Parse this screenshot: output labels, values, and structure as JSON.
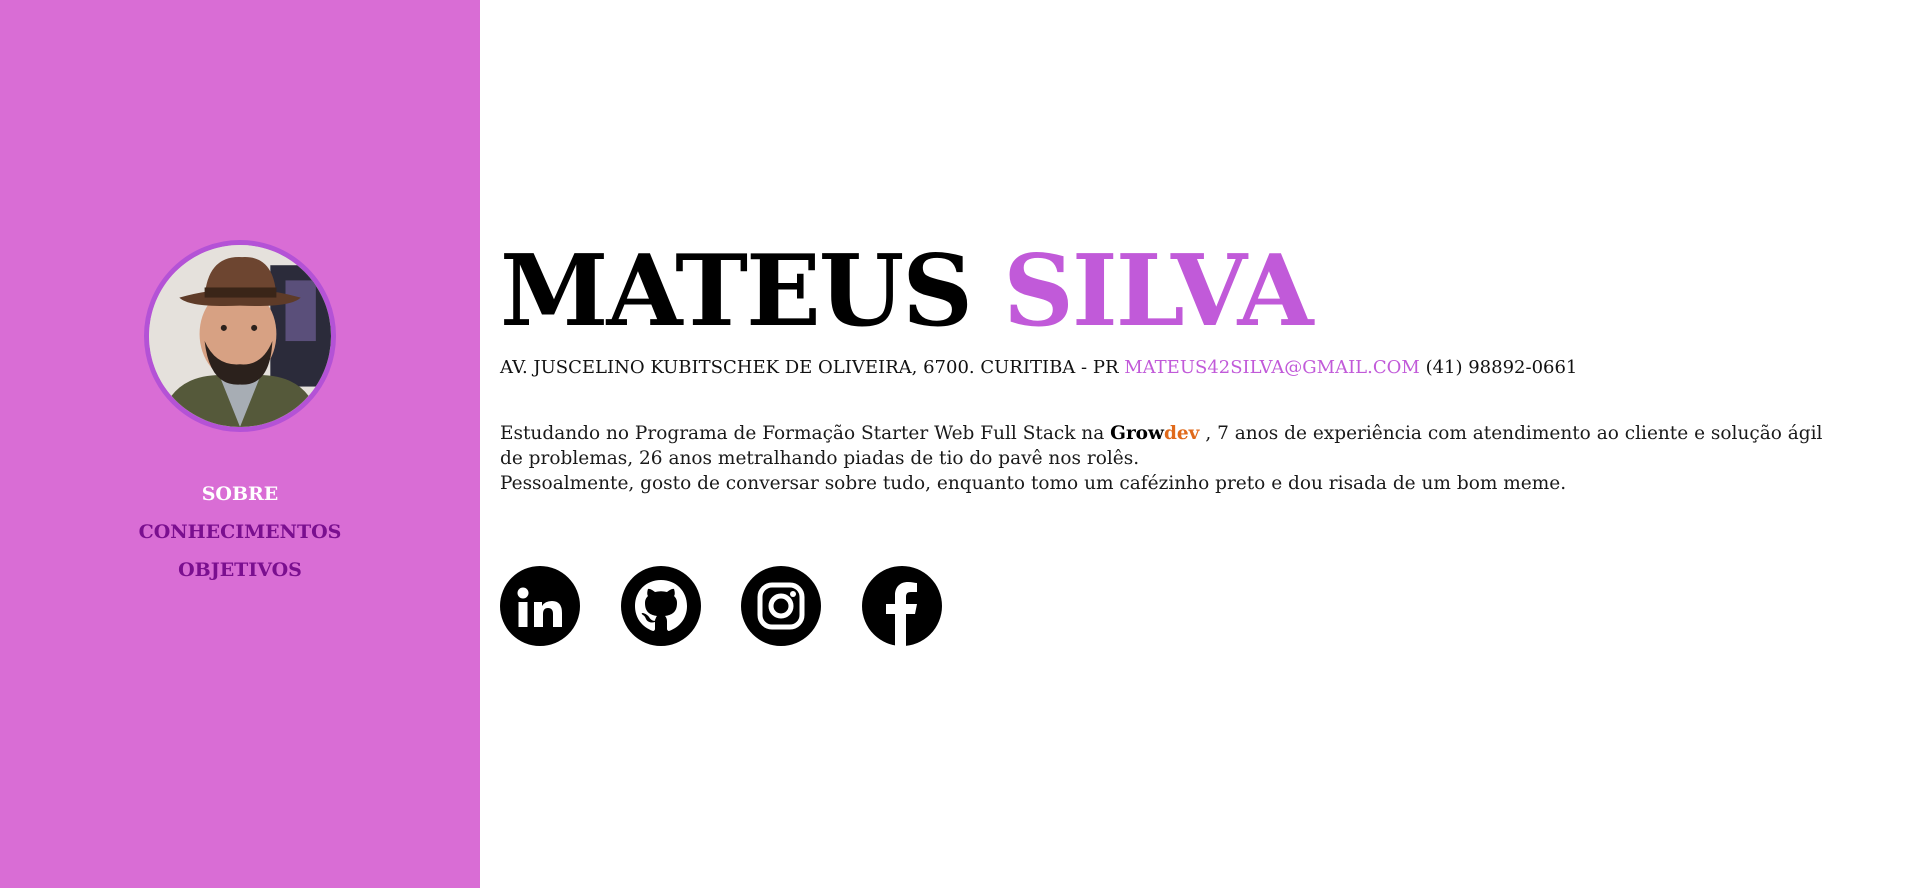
{
  "sidebar": {
    "avatar_icon": "profile-photo",
    "nav": [
      {
        "label": "SOBRE",
        "active": true
      },
      {
        "label": "CONHECIMENTOS",
        "active": false
      },
      {
        "label": "OBJETIVOS",
        "active": false
      }
    ]
  },
  "header": {
    "first_name": "MATEUS",
    "last_name": "SILVA",
    "address": "AV. JUSCELINO KUBITSCHEK DE OLIVEIRA, 6700. CURITIBA - PR",
    "email": "MATEUS42SILVA@GMAIL.COM",
    "phone": "(41) 98892-0661"
  },
  "about": {
    "line1_before": "Estudando no Programa de Formação Starter Web Full Stack na",
    "brand_grow": "Grow",
    "brand_dev": "dev",
    "line1_after": ", 7 anos de experiência com atendimento ao cliente e solução ágil de problemas, 26 anos metralhando piadas de tio do pavê nos rolês.",
    "line2": "Pessoalmente, gosto de conversar sobre tudo, enquanto tomo um cafézinho preto e dou risada de um bom meme."
  },
  "social": [
    "linkedin-icon",
    "github-icon",
    "instagram-icon",
    "facebook-icon"
  ],
  "colors": {
    "sidebar_bg": "#d96dd5",
    "accent": "#c15ad9",
    "nav_inactive": "#7a0f8f",
    "brand_dev": "#e06a1b"
  }
}
